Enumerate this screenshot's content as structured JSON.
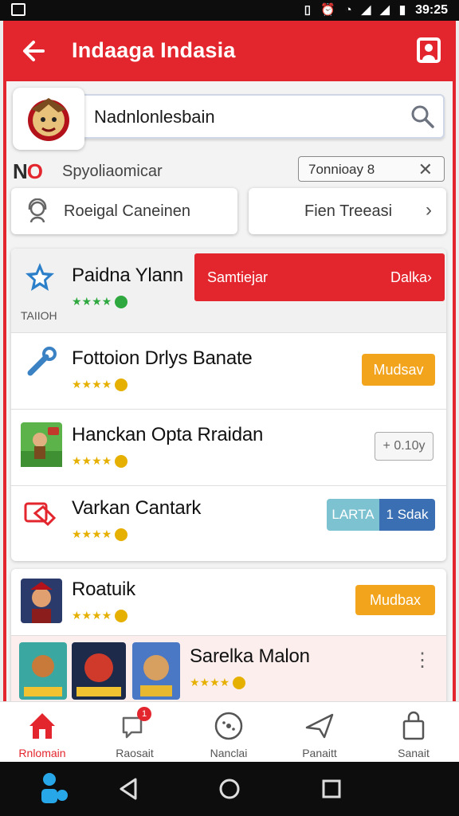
{
  "status_bar": {
    "time": "39:25"
  },
  "app_bar": {
    "title": "Indaaga Indasia"
  },
  "search": {
    "value": "Nadnlonlesbain"
  },
  "filter_row": {
    "logo_prefix": "N",
    "logo_accent": "O",
    "label": "Spyoliaomicar",
    "chip_text": "7onnioay  8"
  },
  "quick_buttons": {
    "left": "Roeigal Caneinen",
    "right": "Fien Treeasi"
  },
  "featured": {
    "name": "Paidna Ylann",
    "tag": "TAIIOH",
    "action_left": "Samtiejar",
    "action_right": "Dalka›"
  },
  "list_items": [
    {
      "name": "Fottoion Drlys Banate",
      "action": "Mudsav"
    },
    {
      "name": "Hanckan Opta Rraidan",
      "action": "+ 0.10y"
    },
    {
      "name": "Varkan Cantark",
      "action_left": "LARTA",
      "action_right": "1 Sdak"
    }
  ],
  "card2": {
    "item_name": "Roatuik",
    "item_action": "Mudbax",
    "strip_name": "Sarelka Malon"
  },
  "bottom_nav": [
    {
      "label": "Rnlomain"
    },
    {
      "label": "Raosait",
      "badge": "1"
    },
    {
      "label": "Nanclai"
    },
    {
      "label": "Panaitt"
    },
    {
      "label": "Sanait"
    }
  ],
  "colors": {
    "brand_red": "#e3262d",
    "orange": "#f2a41c",
    "blue": "#3b6fb3",
    "teal": "#7cc2d1",
    "green": "#3aa84a"
  }
}
